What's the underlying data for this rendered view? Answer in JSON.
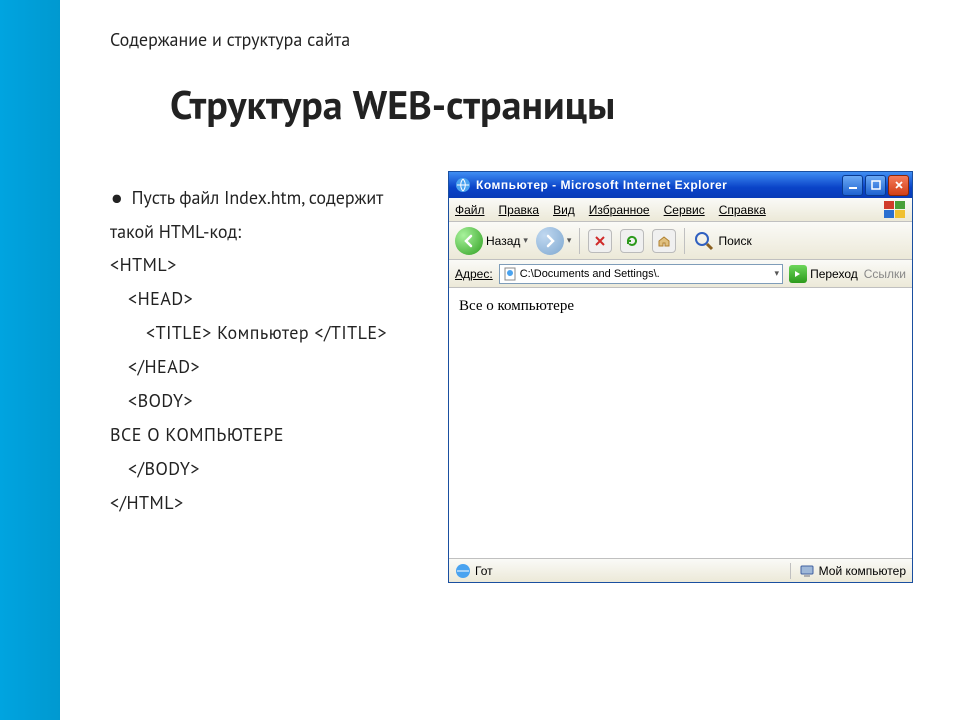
{
  "slide": {
    "topic": "Содержание и структура сайта",
    "title": "Структура WEB-страницы",
    "intro": "Пусть  файл Index.htm, содержит такой HTML-код:",
    "code": {
      "l1": "<HTML>",
      "l2": "<HEAD>",
      "l3": "<TITLE> Компьютер </TITLE>",
      "l4": "</HEAD>",
      "l5": "<BODY>",
      "l6": "ВСЕ О КОМПЬЮТЕРЕ",
      "l7": "</BODY>",
      "l8": "</HTML>"
    }
  },
  "browser": {
    "title": "Компьютер - Microsoft Internet Explorer",
    "menu": {
      "file": "Файл",
      "edit": "Правка",
      "view": "Вид",
      "fav": "Избранное",
      "tools": "Сервис",
      "help": "Справка"
    },
    "toolbar": {
      "back": "Назад",
      "search": "Поиск"
    },
    "addr": {
      "label": "Адрес:",
      "value": "C:\\Documents and Settings\\.",
      "go": "Переход",
      "links": "Ссылки"
    },
    "content": "Все о компьютере",
    "status": {
      "left": "Гот",
      "right": "Мой компьютер"
    }
  }
}
